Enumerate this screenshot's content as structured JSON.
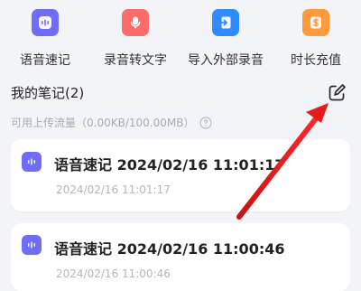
{
  "quick_actions": {
    "items": [
      {
        "label": "语音速记",
        "icon": "waveform-icon",
        "tile_color": "#6f6cf6"
      },
      {
        "label": "录音转文字",
        "icon": "microphone-icon",
        "tile_color": "#ff6b6b"
      },
      {
        "label": "导入外部录音",
        "icon": "import-icon",
        "tile_color": "#2f8bff"
      },
      {
        "label": "时长充值",
        "icon": "recharge-icon",
        "tile_color": "#ff9a3c"
      }
    ]
  },
  "notes": {
    "title": "我的笔记(2)",
    "quota_text": "可用上传流量（0.00KB/100.00MB）",
    "items": [
      {
        "title": "语音速记 2024/02/16 11:01:17",
        "subtitle": "2024/02/16 11:01:17"
      },
      {
        "title": "语音速记 2024/02/16 11:00:46",
        "subtitle": "2024/02/16 11:00:46"
      }
    ]
  },
  "colors": {
    "accent_purple": "#6f6cf6",
    "accent_red": "#ff6b6b",
    "accent_blue": "#2f8bff",
    "accent_orange": "#ff9a3c",
    "annotation_arrow": "#e31b1b",
    "background": "#f3f4f8"
  }
}
